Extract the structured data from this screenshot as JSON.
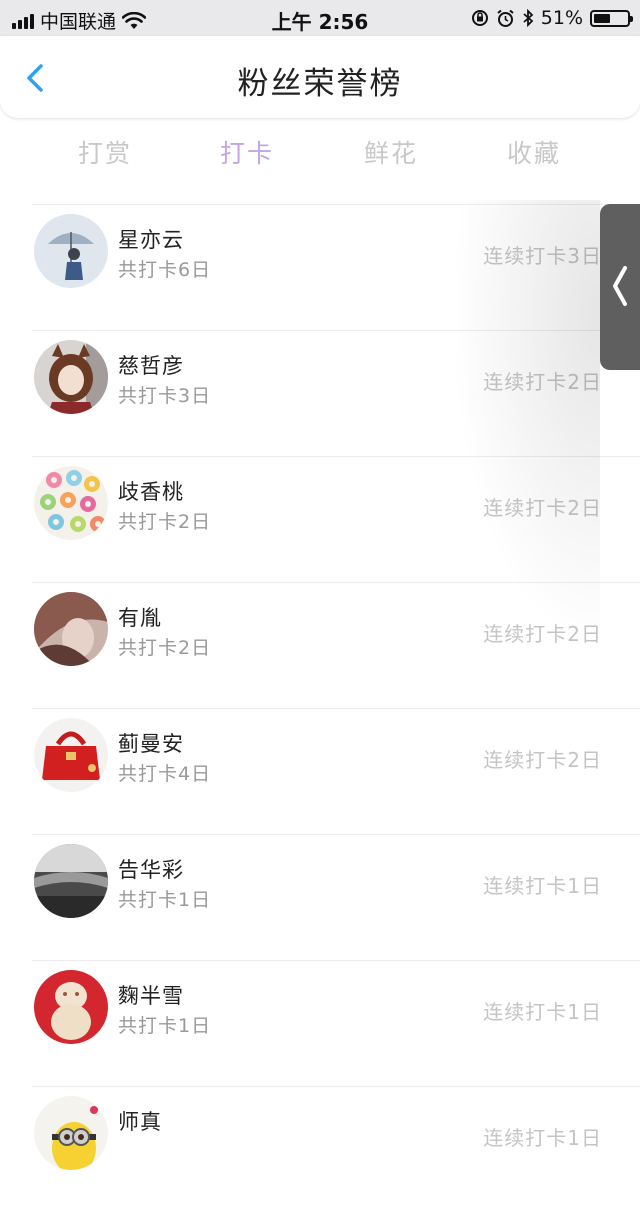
{
  "status_bar": {
    "carrier": "中国联通",
    "time": "上午 2:56",
    "battery": "51%",
    "battery_level": 0.51
  },
  "nav": {
    "title": "粉丝荣誉榜"
  },
  "tabs": [
    {
      "label": "打赏",
      "active": false
    },
    {
      "label": "打卡",
      "active": true
    },
    {
      "label": "鲜花",
      "active": false
    },
    {
      "label": "收藏",
      "active": false
    }
  ],
  "colors": {
    "active_tab": "#c6a4e6",
    "inactive_tab": "#c8c8c8",
    "status_bar_bg": "#e9e9ec"
  },
  "fans": [
    {
      "name": "星亦云",
      "total": "共打卡6日",
      "streak": "连续打卡3日",
      "avatar": "umbrella-girl-avatar"
    },
    {
      "name": "慈哲彦",
      "total": "共打卡3日",
      "streak": "连续打卡2日",
      "avatar": "anime-girl-avatar"
    },
    {
      "name": "歧香桃",
      "total": "共打卡2日",
      "streak": "连续打卡2日",
      "avatar": "donuts-avatar"
    },
    {
      "name": "有胤",
      "total": "共打卡2日",
      "streak": "连续打卡2日",
      "avatar": "blurred-portrait-avatar"
    },
    {
      "name": "蓟曼安",
      "total": "共打卡4日",
      "streak": "连续打卡2日",
      "avatar": "red-handbag-avatar"
    },
    {
      "name": "告华彩",
      "total": "共打卡1日",
      "streak": "连续打卡1日",
      "avatar": "glass-avatar"
    },
    {
      "name": "麴半雪",
      "total": "共打卡1日",
      "streak": "连续打卡1日",
      "avatar": "figurine-avatar"
    },
    {
      "name": "师真",
      "total": "",
      "streak": "连续打卡1日",
      "avatar": "minion-avatar"
    }
  ]
}
